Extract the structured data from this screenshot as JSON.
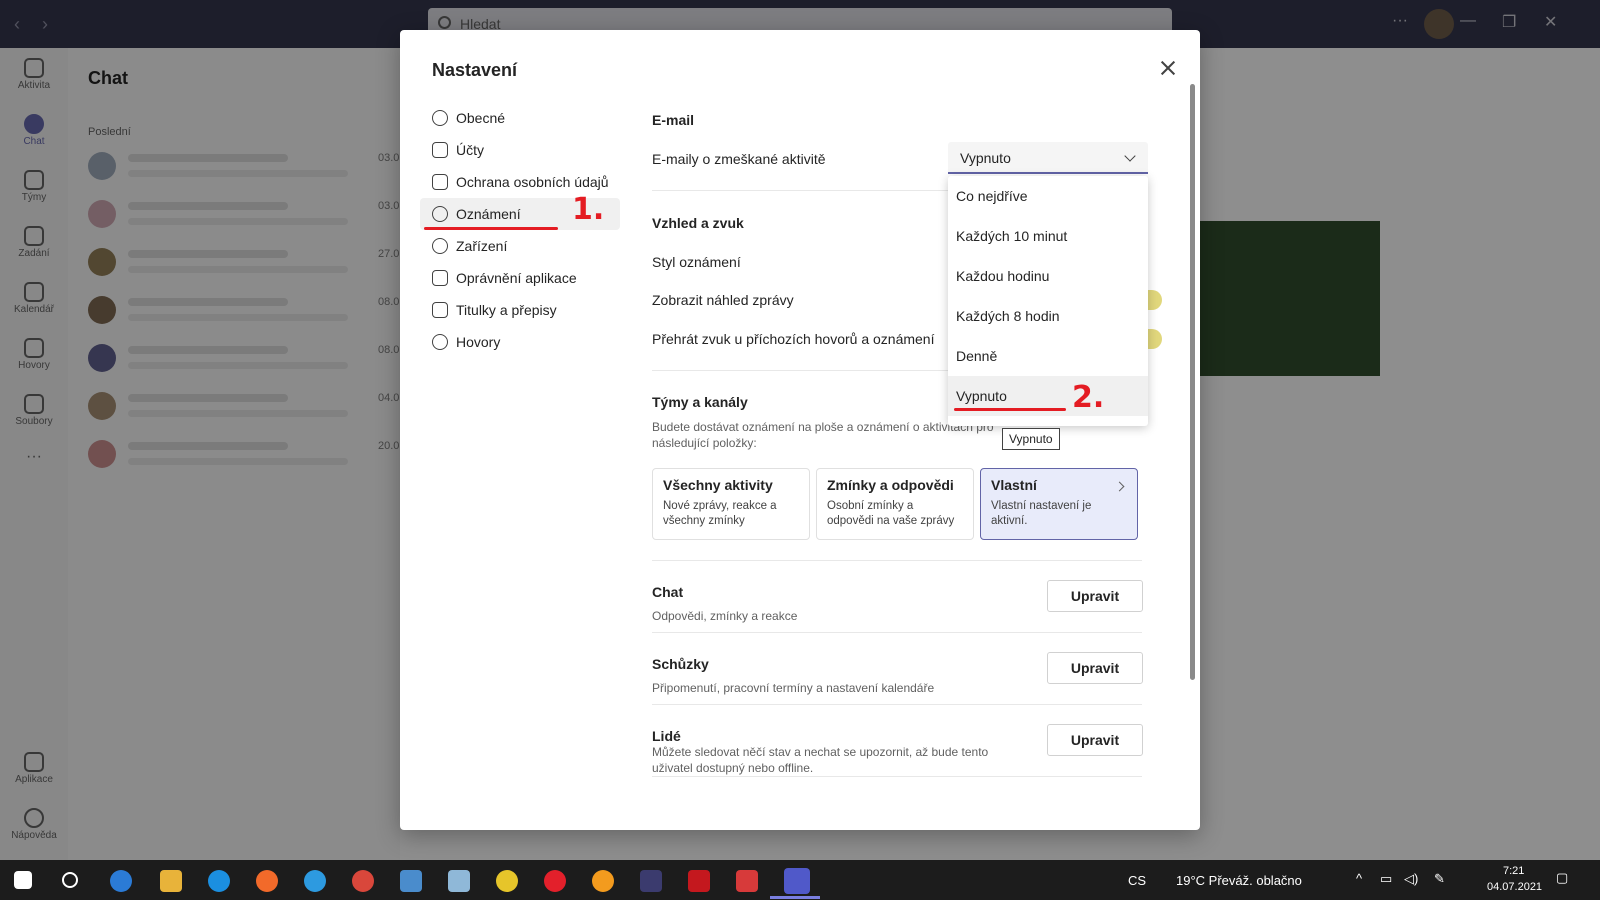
{
  "topbar": {
    "search_placeholder": "Hledat",
    "more": "···"
  },
  "rail": [
    {
      "label": "Aktivita"
    },
    {
      "label": "Chat"
    },
    {
      "label": "Týmy"
    },
    {
      "label": "Zadání"
    },
    {
      "label": "Kalendář"
    },
    {
      "label": "Hovory"
    },
    {
      "label": "Soubory"
    },
    {
      "label": "Aplikace"
    },
    {
      "label": "Nápověda"
    }
  ],
  "chatlist": {
    "title": "Chat",
    "recent_label": "Poslední",
    "dates": [
      "03.0",
      "03.0",
      "27.0",
      "08.0",
      "08.0",
      "04.0",
      "20.0"
    ]
  },
  "modal": {
    "title": "Nastavení",
    "nav": [
      {
        "label": "Obecné"
      },
      {
        "label": "Účty"
      },
      {
        "label": "Ochrana osobních údajů"
      },
      {
        "label": "Oznámení"
      },
      {
        "label": "Zařízení"
      },
      {
        "label": "Oprávnění aplikace"
      },
      {
        "label": "Titulky a přepisy"
      },
      {
        "label": "Hovory"
      }
    ],
    "email": {
      "title": "E-mail",
      "label": "E-maily o zmeškané aktivitě",
      "selected": "Vypnuto",
      "options": [
        "Co nejdříve",
        "Každých 10 minut",
        "Každou hodinu",
        "Každých 8 hodin",
        "Denně",
        "Vypnuto"
      ],
      "tooltip": "Vypnuto"
    },
    "appearance": {
      "title": "Vzhled a zvuk",
      "rows": [
        "Styl oznámení",
        "Zobrazit náhled zprávy",
        "Přehrát zvuk u příchozích hovorů a oznámení"
      ]
    },
    "teams": {
      "title": "Týmy a kanály",
      "desc": "Budete dostávat oznámení na ploše a oznámení o aktivitách pro následující položky:",
      "cards": [
        {
          "title": "Všechny aktivity",
          "desc": "Nové zprávy, reakce a všechny zmínky"
        },
        {
          "title": "Zmínky a odpovědi",
          "desc": "Osobní zmínky a odpovědi na vaše zprávy"
        },
        {
          "title": "Vlastní",
          "desc": "Vlastní nastavení je aktivní."
        }
      ]
    },
    "sections": [
      {
        "title": "Chat",
        "desc": "Odpovědi, zmínky a reakce",
        "button": "Upravit"
      },
      {
        "title": "Schůzky",
        "desc": "Připomenutí, pracovní termíny a nastavení kalendáře",
        "button": "Upravit"
      },
      {
        "title": "Lidé",
        "desc": "Můžete sledovat něčí stav a nechat se upozornit, až bude tento uživatel dostupný nebo offline.",
        "button": "Upravit"
      }
    ],
    "annotations": {
      "step1": "1.",
      "step2": "2."
    }
  },
  "taskbar": {
    "lang": "CS",
    "weather": "19°C  Převáž. oblačno",
    "time": "7:21",
    "date": "04.07.2021"
  },
  "colors": {
    "accent": "#6264a7",
    "annotation": "#e41c23",
    "topbar": "#33344a"
  }
}
